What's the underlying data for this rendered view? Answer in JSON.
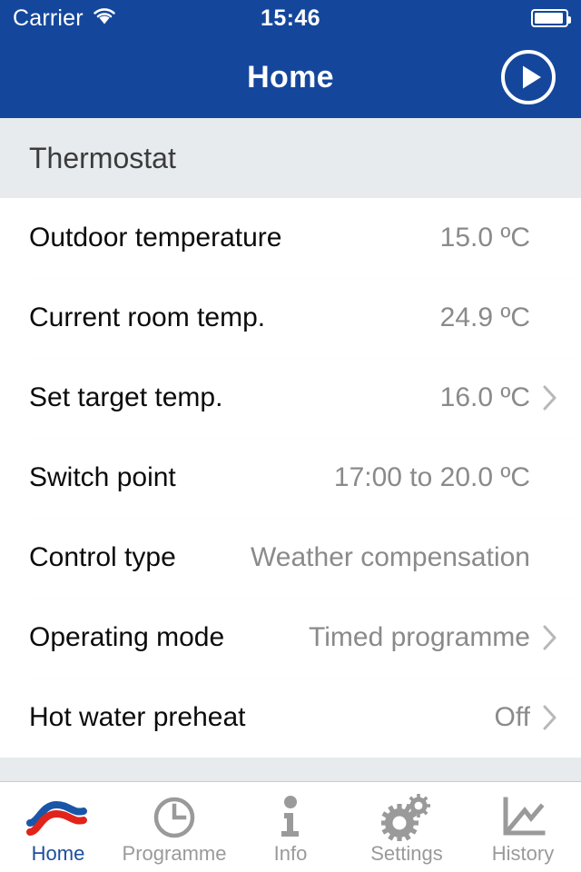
{
  "status_bar": {
    "carrier": "Carrier",
    "wifi_icon": "wifi-icon",
    "time": "15:46",
    "battery_icon": "battery-icon"
  },
  "nav_bar": {
    "title": "Home",
    "action_icon": "play-circle-icon"
  },
  "section": {
    "header": "Thermostat",
    "rows": [
      {
        "label": "Outdoor temperature",
        "value": "15.0 ºC",
        "chevron": false
      },
      {
        "label": "Current room temp.",
        "value": "24.9 ºC",
        "chevron": false
      },
      {
        "label": "Set target temp.",
        "value": "16.0 ºC",
        "chevron": true
      },
      {
        "label": "Switch point",
        "value": "17:00 to 20.0 ºC",
        "chevron": false
      },
      {
        "label": "Control type",
        "value": "Weather compensation",
        "chevron": false
      },
      {
        "label": "Operating mode",
        "value": "Timed programme",
        "chevron": true
      },
      {
        "label": "Hot water preheat",
        "value": "Off",
        "chevron": true
      }
    ]
  },
  "tab_bar": {
    "active_index": 0,
    "tabs": [
      {
        "label": "Home",
        "icon": "wave-logo-icon"
      },
      {
        "label": "Programme",
        "icon": "clock-icon"
      },
      {
        "label": "Info",
        "icon": "info-icon"
      },
      {
        "label": "Settings",
        "icon": "gears-icon"
      },
      {
        "label": "History",
        "icon": "line-chart-icon"
      }
    ]
  },
  "colors": {
    "brand_blue": "#14479C",
    "active_tab_blue": "#1d4e9c",
    "section_gray": "#E7EBEE",
    "value_gray": "#8a8a8a",
    "logo_blue": "#1a56a8",
    "logo_red": "#e2231a"
  }
}
